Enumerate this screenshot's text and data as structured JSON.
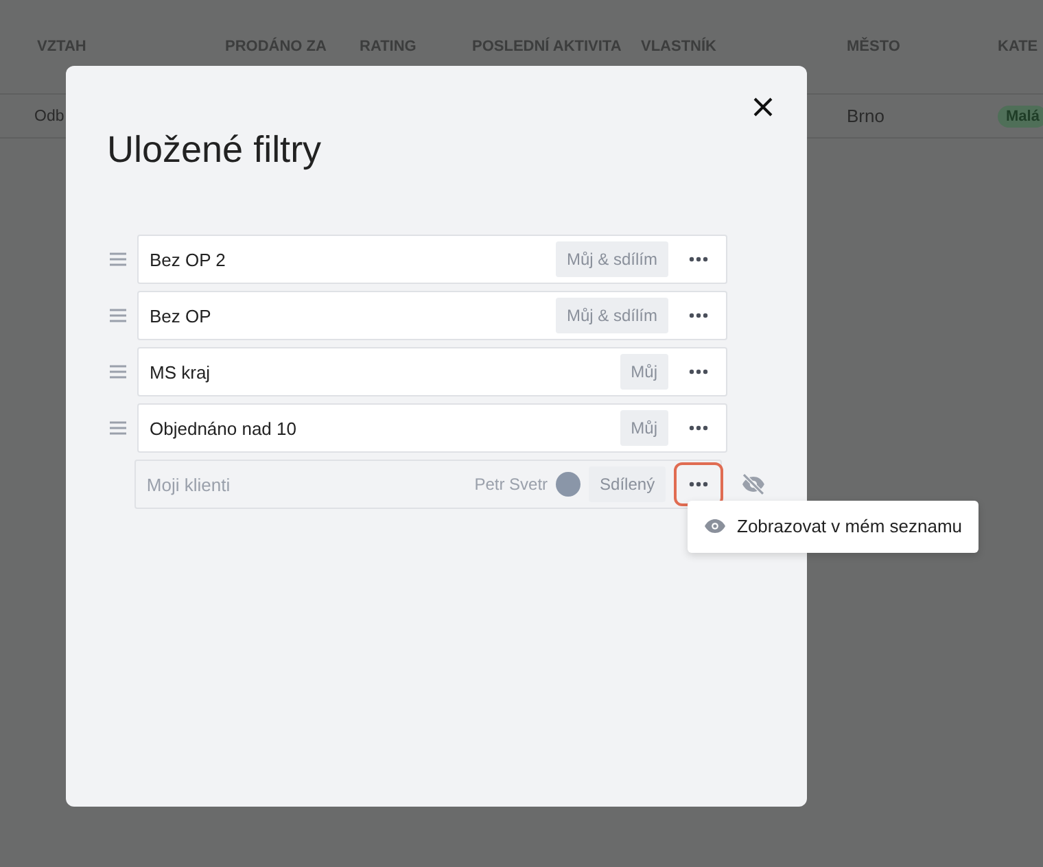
{
  "table": {
    "columns": [
      "VZTAH",
      "PRODÁNO ZA",
      "RATING",
      "POSLEDNÍ AKTIVITA",
      "VLASTNÍK",
      "MĚSTO",
      "KATE"
    ],
    "rows": [
      {
        "cells": [
          "Odb",
          "",
          "",
          "",
          "",
          "Brno"
        ],
        "tag": "Malá"
      }
    ]
  },
  "dialog": {
    "title": "Uložené filtry",
    "filters": [
      {
        "name": "Bez OP 2",
        "sharing": "Můj & sdílím",
        "hidden": false,
        "menu_open": false
      },
      {
        "name": "Bez OP",
        "sharing": "Můj & sdílím",
        "hidden": false,
        "menu_open": false
      },
      {
        "name": "MS kraj",
        "sharing": "Můj",
        "hidden": false,
        "menu_open": false
      },
      {
        "name": "Objednáno nad 10",
        "sharing": "Můj",
        "hidden": false,
        "menu_open": false
      },
      {
        "name": "Moji klienti",
        "owner": "Petr Svetr",
        "sharing": "Sdílený",
        "hidden": true,
        "menu_open": true
      }
    ],
    "menu": {
      "items": [
        "Zobrazovat v mém seznamu"
      ]
    }
  }
}
